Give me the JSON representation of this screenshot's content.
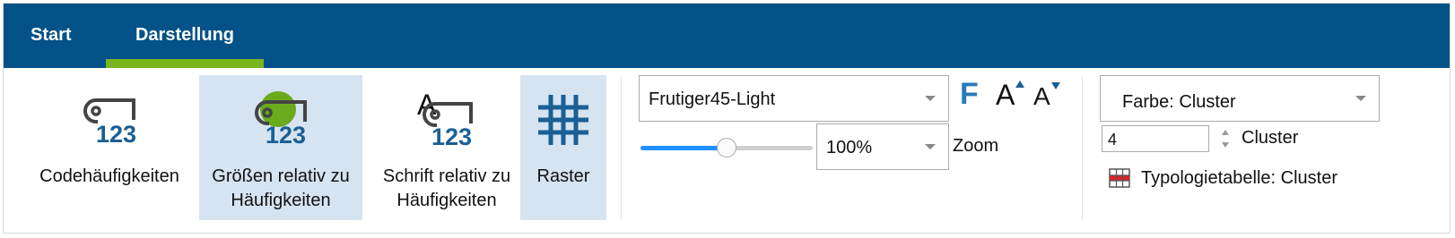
{
  "tabs": [
    {
      "label": "Start"
    },
    {
      "label": "Darstellung"
    }
  ],
  "buttons": {
    "code_freq": {
      "label_line1": "Codehäufigkeiten",
      "label_line2": ""
    },
    "size_rel": {
      "label_line1": "Größen relativ zu",
      "label_line2": "Häufigkeiten"
    },
    "font_rel": {
      "label_line1": "Schrift relativ zu",
      "label_line2": "Häufigkeiten",
      "icon_letter": "A"
    },
    "raster": {
      "label_line1": "Raster"
    }
  },
  "icon_digits": "123",
  "font": {
    "family_value": "Frutiger45-Light",
    "bold_glyph": "F",
    "grow_glyph": "A",
    "shrink_glyph": "A"
  },
  "zoom": {
    "value": "100%",
    "label": "Zoom",
    "slider_fraction": 0.5
  },
  "color": {
    "value": "Farbe: Cluster",
    "cluster_count": "4",
    "cluster_label": "Cluster",
    "typology_label": "Typologietabelle: Cluster"
  },
  "colors": {
    "tabbar": "#045287",
    "accent_green": "#7ab51d",
    "icon_blue": "#1a5f95",
    "selected_bg": "#d6e3f0",
    "slider_blue": "#1e90ff"
  }
}
